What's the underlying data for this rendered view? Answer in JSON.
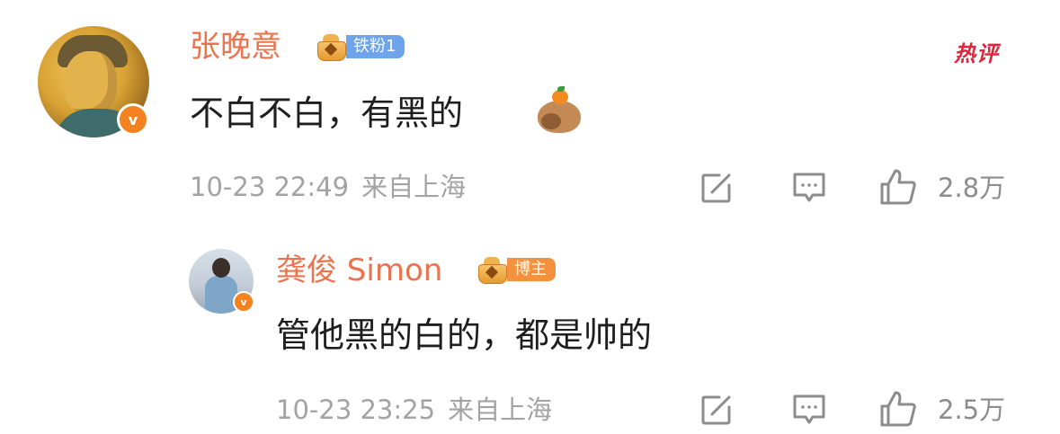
{
  "comments": [
    {
      "username": "张晚意",
      "fan_badge": "铁粉1",
      "text": "不白不白，有黑的",
      "sticker": "capybara-orange-sticker",
      "time": "10-23 22:49",
      "location": "来自上海",
      "likes": "2.8万",
      "hot_tag": "热评"
    },
    {
      "username": "龚俊 Simon",
      "fan_badge": "博主",
      "text": "管他黑的白的，都是帅的",
      "time": "10-23 23:25",
      "location": "来自上海",
      "likes": "2.5万"
    }
  ],
  "verified_mark": "v",
  "colors": {
    "username": "#eb7350",
    "hot_tag": "#e2233e",
    "meta": "#a3a3a3",
    "badge_iron_fan": "#6ea4ea",
    "badge_blogger": "#f4913f",
    "verified": "#f58220"
  },
  "icons": {
    "share": "share-edit-icon",
    "comment": "comment-bubble-icon",
    "like": "thumbs-up-icon"
  }
}
